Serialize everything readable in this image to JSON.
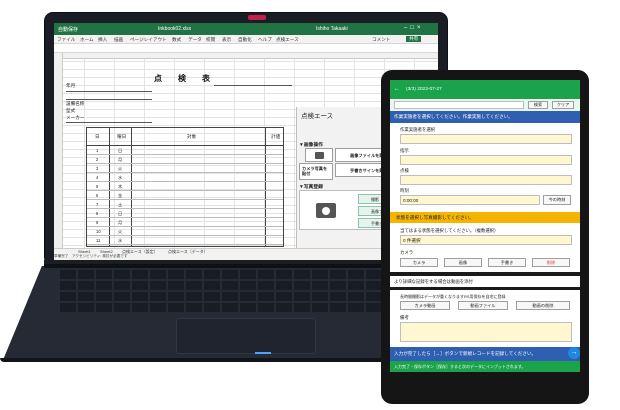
{
  "excel": {
    "title_filename": "Inkbook02.xlsx",
    "title_user": "Ishiho Takaaki",
    "title_left": "自動保存",
    "ribbon": [
      "ファイル",
      "ホーム",
      "挿入",
      "描画",
      "ページレイアウト",
      "数式",
      "データ",
      "校閲",
      "表示",
      "自動化",
      "ヘルプ",
      "点検エース"
    ],
    "ribbon_right": "コメント",
    "share": "共有",
    "sheet_title": "点　検　表",
    "form_labels": [
      "年月",
      "",
      "設備名称",
      "型式",
      "メーカー"
    ],
    "table_headers": [
      "日",
      "曜日",
      "対象",
      "計値"
    ],
    "rows": [
      {
        "day": "1",
        "dow": "日"
      },
      {
        "day": "2",
        "dow": "月"
      },
      {
        "day": "3",
        "dow": "火"
      },
      {
        "day": "4",
        "dow": "水"
      },
      {
        "day": "5",
        "dow": "木"
      },
      {
        "day": "6",
        "dow": "金"
      },
      {
        "day": "7",
        "dow": "土"
      },
      {
        "day": "8",
        "dow": "日"
      },
      {
        "day": "9",
        "dow": "月"
      },
      {
        "day": "10",
        "dow": "火"
      },
      {
        "day": "11",
        "dow": "水"
      }
    ],
    "sheet_tabs": [
      "Sheet1",
      "Sheet2",
      "点検エース（設定）",
      "点検エース（データ）"
    ],
    "status": "準備完了　アクセシビリティ: 検討が必要です"
  },
  "pane": {
    "title": "点検エース",
    "section_image": "▼画像操作",
    "btn_paste_image": "画像ファイルを貼付",
    "btn_camera_photo": "カメラ写真を貼付",
    "btn_handwriting": "手書きサインを貼付",
    "section_register": "▼写真登録",
    "btn_shoot": "撮影",
    "btn_image_file": "画像ファイル",
    "btn_sign": "手書きサイン",
    "keypad_undo": "↶",
    "keypad_copy": "コピー",
    "keypad_paste": "ペースト",
    "keypad_arrows": [
      "←",
      "↑",
      "↓"
    ]
  },
  "tablet": {
    "header_title": "(3/3) 2023-07-27",
    "back_arrow": "←",
    "search_btn": "検索",
    "clear_btn": "クリア",
    "banner_select_worker": "作業実施者を選択してください。作業実施してください。",
    "label_worker": "作業実施者を選択",
    "label_point": "指示",
    "label_note1": "点検",
    "label_time": "時刻",
    "time_value": "0:00:00",
    "now_btn": "今の時刻",
    "banner_status": "状態を選択し写真撮影してください。",
    "label_applicable": "当てはまる状態を選択してください。（複数選択）",
    "selected_count": "0 件選択",
    "label_camera": "カメラ",
    "camera_buttons": [
      "カメラ",
      "画像",
      "手書き",
      "削除"
    ],
    "banner_detail": "より詳細な記録をする場合は動画を添付",
    "label_video": "長時間撮影はデータが重くなりますRS用保存を自宅に登録",
    "video_buttons": [
      "カメラ動画",
      "動画ファイル",
      "動画の削除"
    ],
    "label_remarks": "備考",
    "banner_next": "入力が完了したら［→］ボタンで新規レコードを記録してください。",
    "next_icon": "→",
    "bottom_hint": "入力完了・保存ボタン［保存］すると次のデータにインプットされます。"
  },
  "colors": {
    "excel_green": "#217346",
    "tablet_green": "#1aa34a",
    "tablet_blue": "#2f5fb0",
    "banner_yellow": "#f5b400",
    "input_yellow": "#fff7cf",
    "delete_red": "#e53935"
  }
}
